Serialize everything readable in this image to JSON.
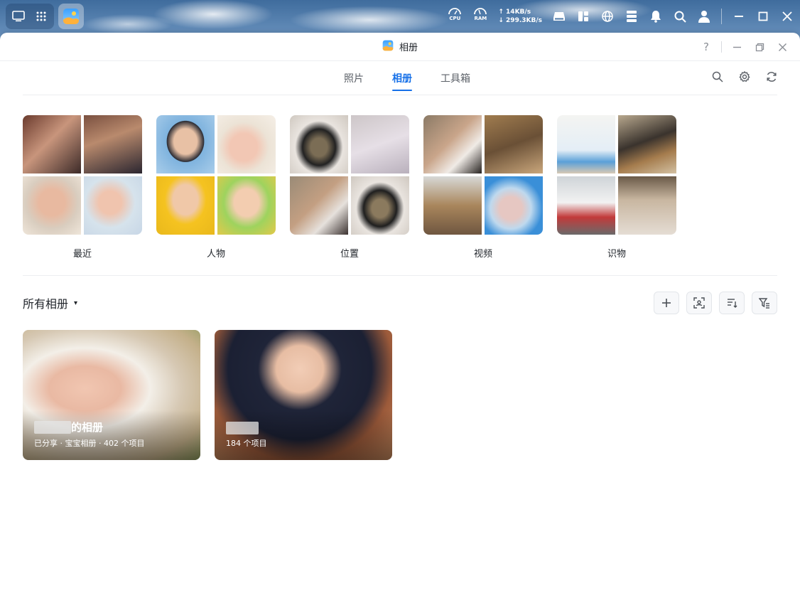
{
  "taskbar": {
    "cpu_label": "CPU",
    "ram_label": "RAM",
    "upload": "↑ 14KB/s",
    "download": "↓ 299.3KB/s"
  },
  "window": {
    "title": "相册",
    "help": "?"
  },
  "tabs": [
    {
      "label": "照片",
      "active": false
    },
    {
      "label": "相册",
      "active": true
    },
    {
      "label": "工具箱",
      "active": false
    }
  ],
  "categories": [
    {
      "label": "最近"
    },
    {
      "label": "人物"
    },
    {
      "label": "位置"
    },
    {
      "label": "视频"
    },
    {
      "label": "识物"
    }
  ],
  "albums_section": {
    "title": "所有相册",
    "caret": "▾"
  },
  "albums": [
    {
      "name_suffix": "的相册",
      "meta": "已分享 · 宝宝相册 · 402 个项目"
    },
    {
      "name_suffix": "",
      "meta": "184 个项目"
    }
  ],
  "colors": {
    "accent": "#1670e8",
    "text": "#1f2329",
    "muted": "#5c6168"
  }
}
